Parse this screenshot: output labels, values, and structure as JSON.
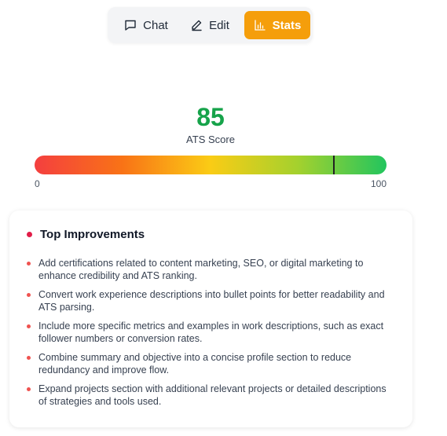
{
  "tabs": [
    {
      "label": "Chat",
      "icon": "chat-bubble-icon"
    },
    {
      "label": "Edit",
      "icon": "pencil-icon"
    },
    {
      "label": "Stats",
      "icon": "bar-chart-icon",
      "active": true
    }
  ],
  "score": {
    "value": "85",
    "label": "ATS Score",
    "min": "0",
    "max": "100",
    "fraction": 0.85
  },
  "improvements": {
    "title": "Top Improvements",
    "items": [
      "Add certifications related to content marketing, SEO, or digital marketing to enhance credibility and ATS ranking.",
      "Convert work experience descriptions into bullet points for better readability and ATS parsing.",
      "Include more specific metrics and examples in work descriptions, such as exact follower numbers or conversion rates.",
      "Combine summary and objective into a concise profile section to reduce redundancy and improve flow.",
      "Expand projects section with additional relevant projects or detailed descriptions of strategies and tools used."
    ]
  },
  "colors": {
    "accent": "#f59e0b",
    "score": "#16a34a",
    "bullet": "#ef5350"
  }
}
